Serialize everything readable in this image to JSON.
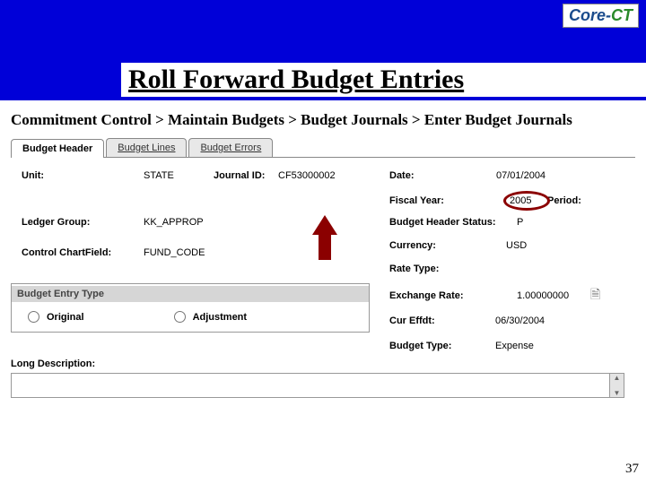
{
  "logo": {
    "part1": "Core-",
    "part2": "CT"
  },
  "slide_title": "Roll Forward Budget Entries",
  "breadcrumb": "Commitment Control > Maintain Budgets > Budget Journals > Enter Budget Journals",
  "tabs": {
    "header": "Budget Header",
    "lines": "Budget Lines",
    "errors": "Budget Errors"
  },
  "labels": {
    "unit": "Unit:",
    "journal_id": "Journal ID:",
    "date": "Date:",
    "fiscal_year": "Fiscal Year:",
    "period": "Period:",
    "ledger_group": "Ledger Group:",
    "header_status": "Budget Header Status:",
    "control_cf": "Control ChartField:",
    "currency": "Currency:",
    "rate_type": "Rate Type:",
    "exchange_rate": "Exchange Rate:",
    "cur_effdt": "Cur Effdt:",
    "budget_type": "Budget Type:",
    "entry_type": "Budget Entry Type",
    "original": "Original",
    "adjustment": "Adjustment",
    "long_desc": "Long Description:"
  },
  "values": {
    "unit": "STATE",
    "journal_id": "CF53000002",
    "date": "07/01/2004",
    "fiscal_year": "2005",
    "ledger_group": "KK_APPROP",
    "header_status": "P",
    "control_cf": "FUND_CODE",
    "currency": "USD",
    "exchange_rate": "1.00000000",
    "cur_effdt": "06/30/2004",
    "budget_type": "Expense"
  },
  "page_num": "37"
}
